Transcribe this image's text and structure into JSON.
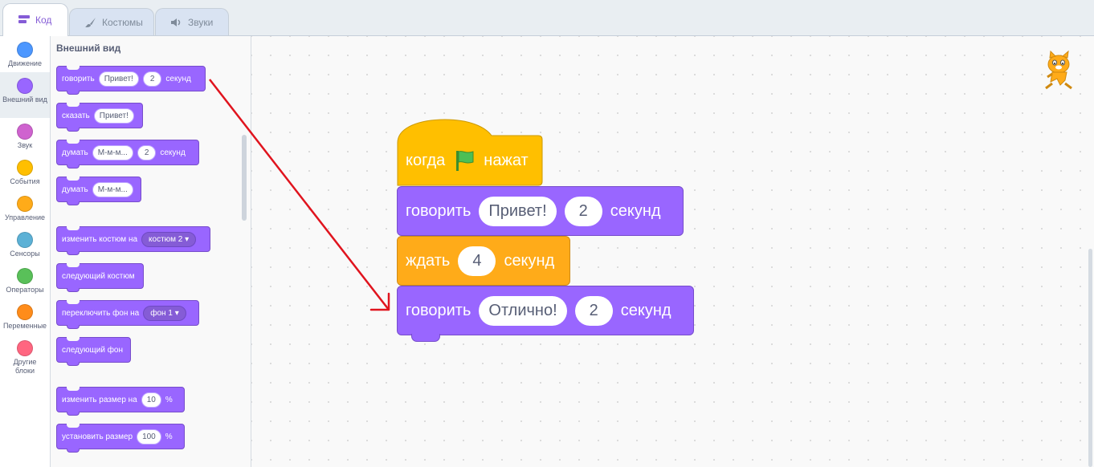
{
  "tabs": [
    {
      "label": "Код"
    },
    {
      "label": "Костюмы"
    },
    {
      "label": "Звуки"
    }
  ],
  "categories": [
    {
      "label": "Движение",
      "color": "#4c97ff"
    },
    {
      "label": "Внешний вид",
      "color": "#9966ff"
    },
    {
      "label": "Звук",
      "color": "#cf63cf"
    },
    {
      "label": "События",
      "color": "#ffbf00"
    },
    {
      "label": "Управление",
      "color": "#ffab19"
    },
    {
      "label": "Сенсоры",
      "color": "#5cb1d6"
    },
    {
      "label": "Операторы",
      "color": "#59c059"
    },
    {
      "label": "Переменные",
      "color": "#ff8c1a"
    },
    {
      "label": "Другие блоки",
      "color": "#ff6680"
    }
  ],
  "palette": {
    "title": "Внешний вид",
    "blocks": {
      "say_secs": {
        "label": "говорить",
        "input": "Привет!",
        "secs": "2",
        "unit": "секунд"
      },
      "say": {
        "label": "сказать",
        "input": "Привет!"
      },
      "think_secs": {
        "label": "думать",
        "input": "М-м-м...",
        "secs": "2",
        "unit": "секунд"
      },
      "think": {
        "label": "думать",
        "input": "М-м-м..."
      },
      "switch_costume": {
        "label": "изменить костюм на",
        "dropdown": "костюм 2"
      },
      "next_costume": {
        "label": "следующий костюм"
      },
      "switch_backdrop": {
        "label": "переключить фон на",
        "dropdown": "фон 1"
      },
      "next_backdrop": {
        "label": "следующий фон"
      },
      "change_size": {
        "label": "изменить размер на",
        "input": "10",
        "unit": "%"
      },
      "set_size": {
        "label": "установить размер",
        "input": "100",
        "unit": "%"
      }
    }
  },
  "script": {
    "hat": {
      "label1": "когда",
      "label2": "нажат"
    },
    "say1": {
      "label": "говорить",
      "input": "Привет!",
      "secs": "2",
      "unit": "секунд"
    },
    "wait": {
      "label": "ждать",
      "secs": "4",
      "unit": "секунд"
    },
    "say2": {
      "label": "говорить",
      "input": "Отлично!",
      "secs": "2",
      "unit": "секунд"
    }
  },
  "colors": {
    "looks": "#9966ff",
    "control": "#ffab19",
    "events": "#ffbf00",
    "accent": "#855cd6",
    "arrow": "#e0141e"
  }
}
